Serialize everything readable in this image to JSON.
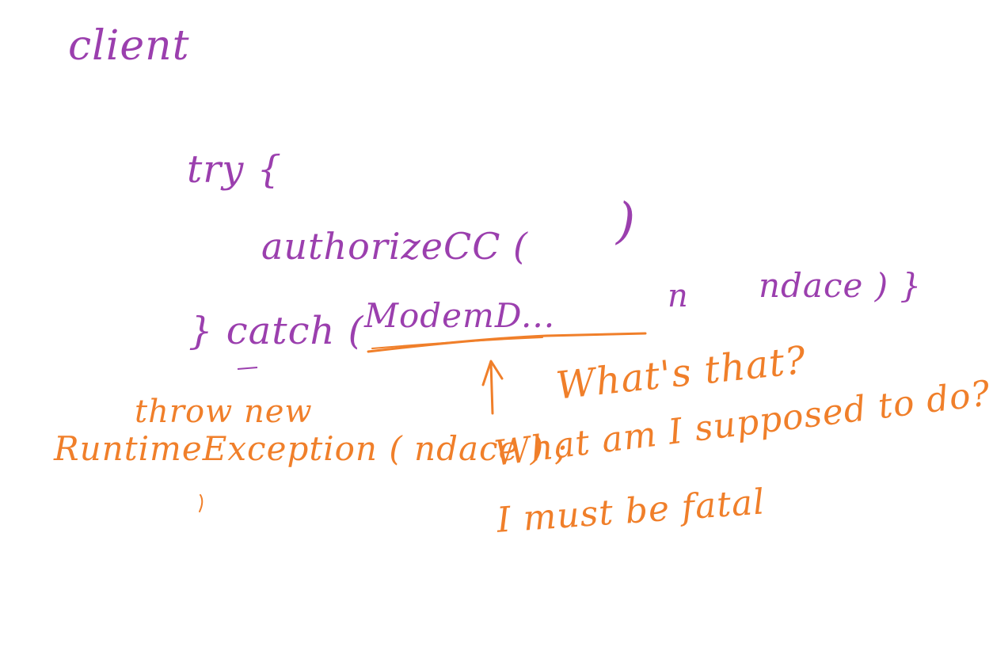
{
  "colors": {
    "purple_ink": "#9b3fae",
    "orange_ink": "#f07f2a",
    "background": "#ffffff"
  },
  "purple_notes": {
    "title": "client",
    "try_open": "try {",
    "call": "authorizeCC (",
    "call_close": ")",
    "catch_prefix": "} catch (",
    "exception_type": "ModemD...",
    "exception_var": "n",
    "catch_tail": "ndace ) }"
  },
  "orange_notes": {
    "throw_line1": "throw new",
    "throw_line2": "RuntimeException ( ndace ) ;",
    "question1": "What's that?",
    "question2": "What am I supposed to do?",
    "question3": "I must be fatal"
  }
}
